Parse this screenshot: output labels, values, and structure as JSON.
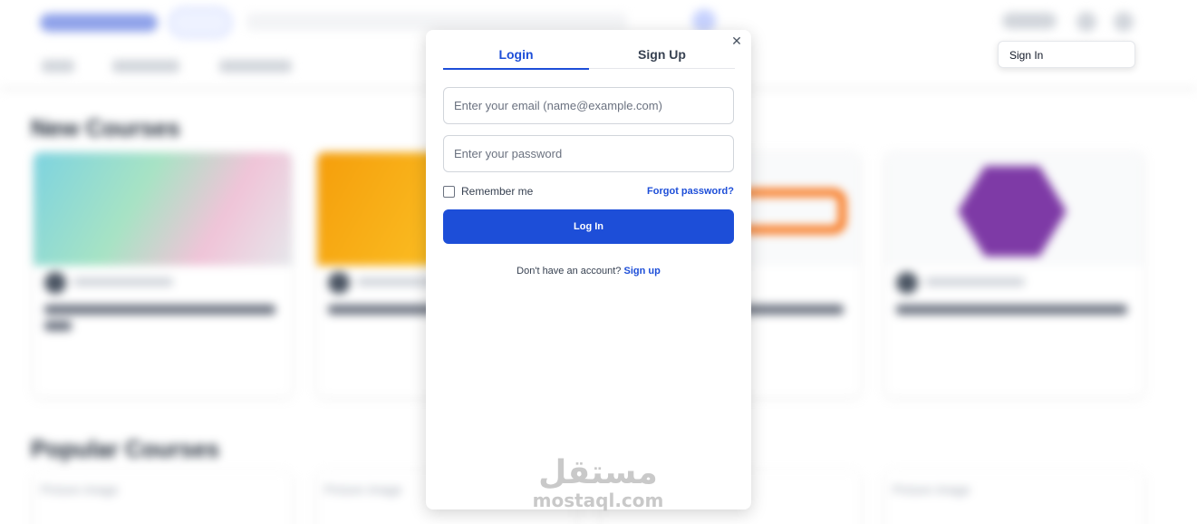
{
  "background": {
    "sections": {
      "new_courses_title": "New Courses",
      "popular_courses_title": "Popular Courses",
      "picture_placeholder": "Picture image"
    },
    "cards": [
      {
        "accent": "#7dd3e0",
        "accent2": "#f0c4d8",
        "icon": "colorful-blob-image"
      },
      {
        "accent": "#f59e0b",
        "accent2": "#fbbf24",
        "icon": "orange-tile-image"
      },
      {
        "accent": "#f3f4f6",
        "accent2": "#f97316",
        "icon": "sql-logo-image"
      },
      {
        "accent": "#f3f4f6",
        "accent2": "#7e3aa6",
        "icon": "c-language-logo-image"
      }
    ]
  },
  "signin_popup": {
    "label": "Sign In"
  },
  "modal": {
    "close_icon": "✕",
    "tabs": [
      {
        "label": "Login",
        "active": true
      },
      {
        "label": "Sign Up",
        "active": false
      }
    ],
    "email_placeholder": "Enter your email (name@example.com)",
    "password_placeholder": "Enter your password",
    "remember_label": "Remember me",
    "forgot_label": "Forgot password?",
    "login_button": "Log In",
    "signup_prompt": "Don't have an account?",
    "signup_link": "Sign up"
  },
  "watermark": {
    "arabic": "مستقل",
    "latin": "mostaql.com"
  },
  "colors": {
    "primary": "#1d4ed8",
    "border": "#d1d5db"
  }
}
